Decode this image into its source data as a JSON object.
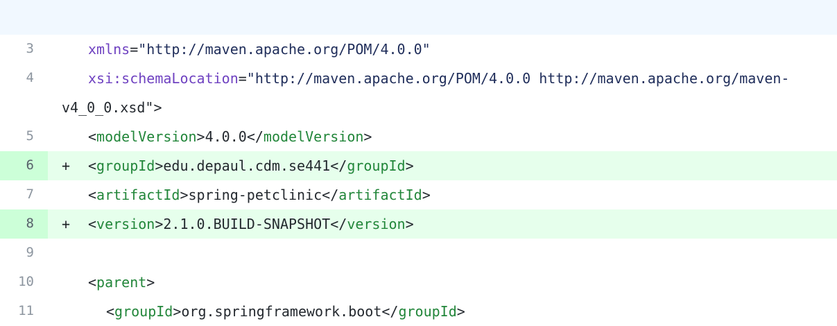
{
  "diff": {
    "lines": [
      {
        "num": "3",
        "type": "context",
        "marker": "",
        "attr": "xmlns",
        "eq": "=",
        "value": "\"http://maven.apache.org/POM/4.0.0\""
      },
      {
        "num": "4",
        "type": "context",
        "marker": "",
        "attr": "xsi:schemaLocation",
        "eq": "=",
        "value": "\"http://maven.apache.org/POM/4.0.0 http://maven.apache.org/maven-",
        "cont": "v4_0_0.xsd\">"
      },
      {
        "num": "5",
        "type": "context",
        "marker": "",
        "open_lt": "<",
        "tag": "modelVersion",
        "open_gt": ">",
        "text": "4.0.0",
        "close_lt": "</",
        "close_tag": "modelVersion",
        "close_gt": ">"
      },
      {
        "num": "6",
        "type": "added",
        "marker": "+",
        "open_lt": "<",
        "tag": "groupId",
        "open_gt": ">",
        "text": "edu.depaul.cdm.se441",
        "close_lt": "</",
        "close_tag": "groupId",
        "close_gt": ">"
      },
      {
        "num": "7",
        "type": "context",
        "marker": "",
        "open_lt": "<",
        "tag": "artifactId",
        "open_gt": ">",
        "text": "spring-petclinic",
        "close_lt": "</",
        "close_tag": "artifactId",
        "close_gt": ">"
      },
      {
        "num": "8",
        "type": "added",
        "marker": "+",
        "open_lt": "<",
        "tag": "version",
        "open_gt": ">",
        "text": "2.1.0.BUILD-SNAPSHOT",
        "close_lt": "</",
        "close_tag": "version",
        "close_gt": ">"
      },
      {
        "num": "9",
        "type": "context",
        "marker": ""
      },
      {
        "num": "10",
        "type": "context",
        "marker": "",
        "open_lt": "<",
        "tag": "parent",
        "open_gt": ">"
      },
      {
        "num": "11",
        "type": "context",
        "marker": "",
        "open_lt": "<",
        "tag": "groupId",
        "open_gt": ">",
        "text": "org.springframework.boot",
        "close_lt": "</",
        "close_tag": "groupId",
        "close_gt": ">"
      }
    ]
  },
  "colors": {
    "added_bg": "#e6ffec",
    "added_gutter_bg": "#ccffd8",
    "hunk_header_bg": "#f1f8ff",
    "tag": "#22863a",
    "attr": "#6f42c1"
  }
}
